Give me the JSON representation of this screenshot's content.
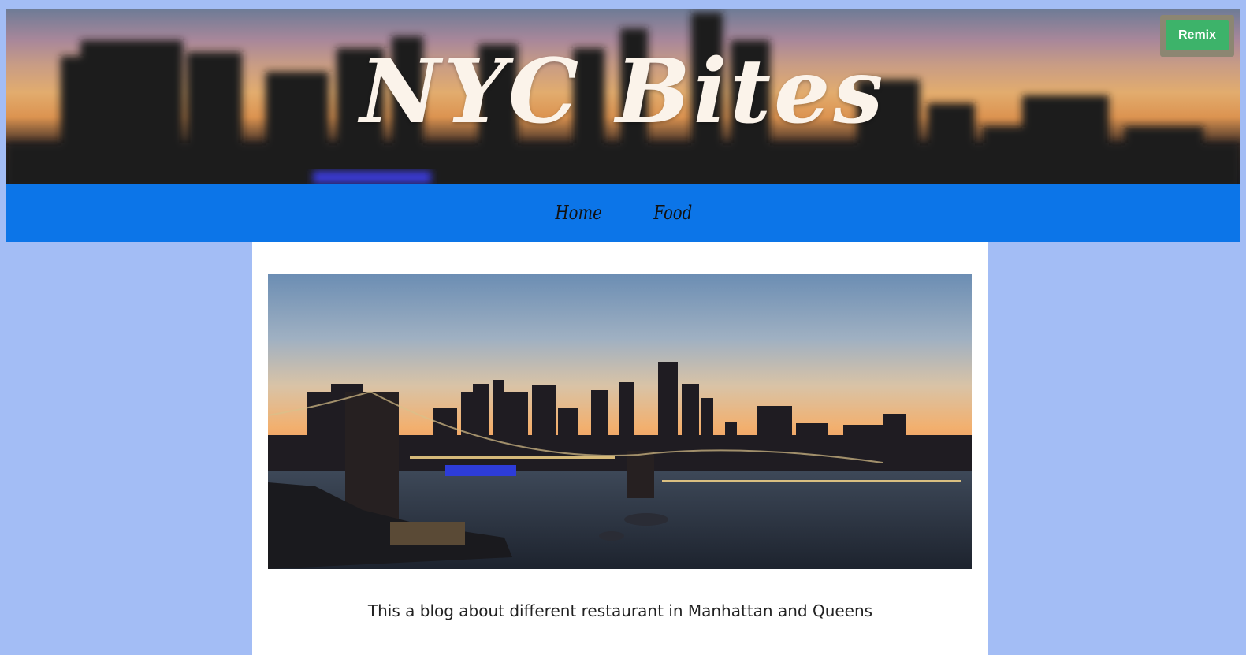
{
  "header": {
    "title": "NYC Bites",
    "remix_label": "Remix"
  },
  "nav": {
    "items": [
      {
        "label": "Home"
      },
      {
        "label": "Food"
      }
    ]
  },
  "main": {
    "caption": "This a blog about different restaurant in Manhattan and Queens"
  },
  "colors": {
    "page_background": "#a3bdf5",
    "nav_background": "#0c75e8",
    "remix_button": "#3db36a",
    "title_text": "#fbf3ea"
  }
}
